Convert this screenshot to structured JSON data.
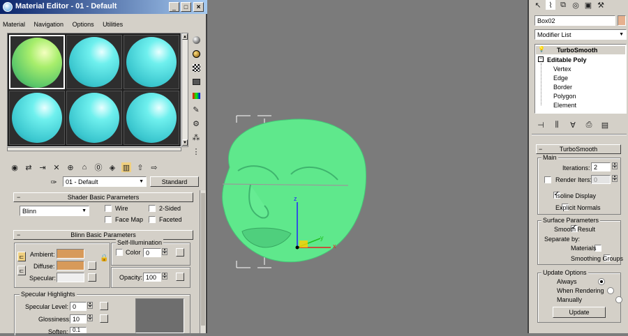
{
  "material_editor": {
    "title": "Material Editor - 01 - Default",
    "menus": [
      "Material",
      "Navigation",
      "Options",
      "Utilities"
    ],
    "material_name": "01 - Default",
    "material_type": "Standard",
    "shader_rollout": "Shader Basic Parameters",
    "shader_type": "Blinn",
    "wire_label": "Wire",
    "two_sided_label": "2-Sided",
    "face_map_label": "Face Map",
    "faceted_label": "Faceted",
    "blinn_rollout": "Blinn Basic Parameters",
    "self_illum_label": "Self-Illumination",
    "color_label": "Color",
    "color_value": "0",
    "ambient_label": "Ambient:",
    "diffuse_label": "Diffuse:",
    "specular_label": "Specular:",
    "opacity_label": "Opacity:",
    "opacity_value": "100",
    "specular_highlights_label": "Specular Highlights",
    "specular_level_label": "Specular Level:",
    "specular_level_value": "0",
    "glossiness_label": "Glossiness:",
    "glossiness_value": "10",
    "soften_label": "Soften:",
    "soften_value": "0.1",
    "ambient_color": "#d79a5a",
    "diffuse_color": "#d79a5a",
    "specular_color": "#efefef"
  },
  "command_panel": {
    "object_name": "Box02",
    "object_color": "#e6b08e",
    "modifier_list_label": "Modifier List",
    "stack": [
      {
        "label": "TurboSmooth",
        "bold": true
      },
      {
        "label": "Editable Poly",
        "bold": true
      },
      {
        "label": "Vertex"
      },
      {
        "label": "Edge"
      },
      {
        "label": "Border"
      },
      {
        "label": "Polygon"
      },
      {
        "label": "Element"
      }
    ],
    "rollout_title": "TurboSmooth",
    "main_label": "Main",
    "iterations_label": "Iterations:",
    "iterations_value": "2",
    "render_iters_label": "Render Iters:",
    "render_iters_value": "0",
    "isoline_label": "Isoline Display",
    "explicit_normals_label": "Explicit Normals",
    "surface_params_label": "Surface Parameters",
    "smooth_result_label": "Smooth Result",
    "separate_by_label": "Separate by:",
    "materials_label": "Materials",
    "smoothing_groups_label": "Smoothing Groups",
    "update_options_label": "Update Options",
    "always_label": "Always",
    "when_rendering_label": "When Rendering",
    "manually_label": "Manually",
    "update_button": "Update"
  },
  "viewport": {
    "axis_z": "z",
    "axis_y": "y",
    "axis_x": "x",
    "object_color": "#5fe88c"
  }
}
